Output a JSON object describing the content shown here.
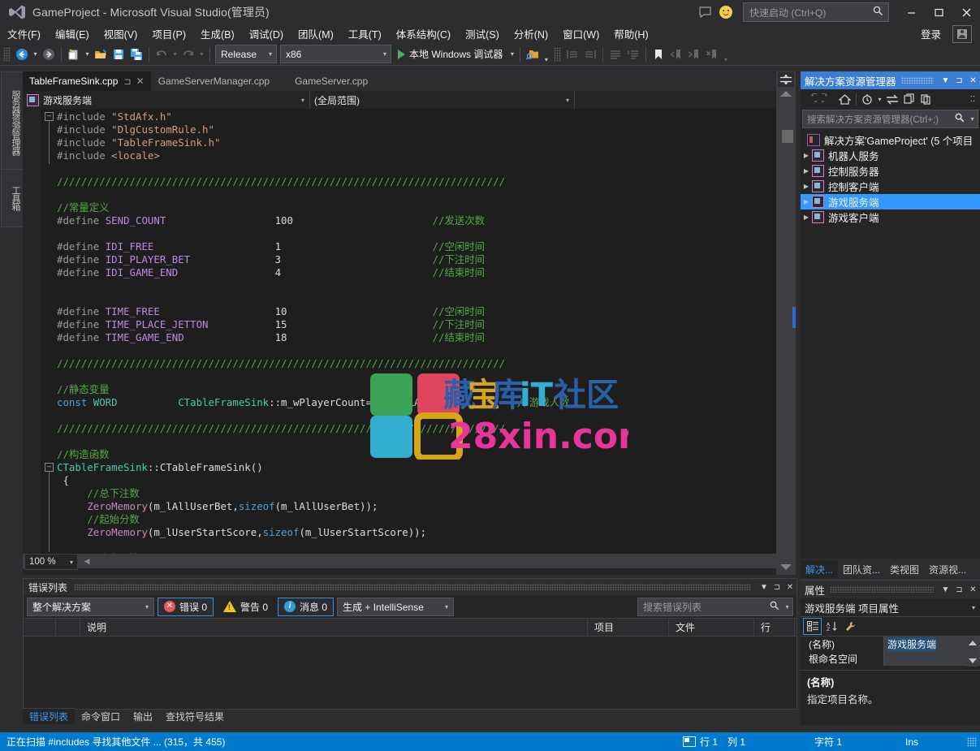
{
  "window": {
    "title": "GameProject - Microsoft Visual Studio(管理员)",
    "logo_icon": "visual-studio-logo",
    "feedback_icon": "feedback-smiley-icon",
    "minimize": "—",
    "maximize": "▢",
    "close": "✕",
    "signin_label": "登录",
    "account_icon": "account-icon"
  },
  "quick_launch": {
    "placeholder": "快速启动 (Ctrl+Q)",
    "icon": "search-icon"
  },
  "menu": [
    "文件(F)",
    "编辑(E)",
    "视图(V)",
    "项目(P)",
    "生成(B)",
    "调试(D)",
    "团队(M)",
    "工具(T)",
    "体系结构(C)",
    "测试(S)",
    "分析(N)",
    "窗口(W)",
    "帮助(H)"
  ],
  "toolbar": {
    "nav_back_icon": "navigate-back-icon",
    "nav_forward_icon": "navigate-forward-icon",
    "new_item_icon": "new-item-icon",
    "open_file_icon": "open-folder-icon",
    "save_icon": "save-icon",
    "save_all_icon": "save-all-icon",
    "undo_icon": "undo-icon",
    "redo_icon": "redo-icon",
    "config_value": "Release",
    "platform_value": "x86",
    "debug_target": "本地 Windows 调试器",
    "find_icon": "find-in-files-icon",
    "outdent_icon": "outdent-icon",
    "indent_icon": "indent-icon",
    "comment_icon": "comment-lines-icon",
    "uncomment_icon": "uncomment-lines-icon",
    "bookmark_icon": "bookmark-icon",
    "prev_bookmark_icon": "previous-bookmark-icon",
    "next_bookmark_icon": "next-bookmark-icon",
    "clear_bookmark_icon": "clear-bookmarks-icon"
  },
  "left_rail": [
    {
      "label": "服务器资源管理器"
    },
    {
      "label": "工具箱"
    }
  ],
  "editor": {
    "tabs": [
      {
        "label": "TableFrameSink.cpp",
        "active": true,
        "pin": "⊐",
        "close": "✕"
      },
      {
        "label": "GameServerManager.cpp",
        "active": false
      },
      {
        "label": "GameServer.cpp",
        "active": false
      }
    ],
    "tab_overflow_icon": "chevron-down-icon",
    "nav_project": "游戏服务端",
    "nav_scope": "(全局范围)",
    "nav_member": "",
    "zoom_level": "100 %",
    "code_lines": [
      [
        {
          "t": "#include ",
          "c": "c-pre"
        },
        {
          "t": "\"StdAfx.h\"",
          "c": "c-str"
        }
      ],
      [
        {
          "t": "#include ",
          "c": "c-pre"
        },
        {
          "t": "\"DlgCustomRule.h\"",
          "c": "c-str"
        }
      ],
      [
        {
          "t": "#include ",
          "c": "c-pre"
        },
        {
          "t": "\"TableFrameSink.h\"",
          "c": "c-str"
        }
      ],
      [
        {
          "t": "#include ",
          "c": "c-pre"
        },
        {
          "t": "<locale>",
          "c": "c-str"
        }
      ],
      [],
      [
        {
          "t": "//////////////////////////////////////////////////////////////////////////",
          "c": "c-cmt"
        }
      ],
      [],
      [
        {
          "t": "//常量定义",
          "c": "c-cmt"
        }
      ],
      [
        {
          "t": "#define ",
          "c": "c-pre"
        },
        {
          "t": "SEND_COUNT",
          "c": "c-mac"
        },
        {
          "t": "                  100                       ",
          "c": "c-id"
        },
        {
          "t": "//发送次数",
          "c": "c-cmt"
        }
      ],
      [],
      [
        {
          "t": "#define ",
          "c": "c-pre"
        },
        {
          "t": "IDI_FREE",
          "c": "c-mac"
        },
        {
          "t": "                    1                         ",
          "c": "c-id"
        },
        {
          "t": "//空闲时间",
          "c": "c-cmt"
        }
      ],
      [
        {
          "t": "#define ",
          "c": "c-pre"
        },
        {
          "t": "IDI_PLAYER_BET",
          "c": "c-mac"
        },
        {
          "t": "              3                         ",
          "c": "c-id"
        },
        {
          "t": "//下注时间",
          "c": "c-cmt"
        }
      ],
      [
        {
          "t": "#define ",
          "c": "c-pre"
        },
        {
          "t": "IDI_GAME_END",
          "c": "c-mac"
        },
        {
          "t": "                4                         ",
          "c": "c-id"
        },
        {
          "t": "//结束时间",
          "c": "c-cmt"
        }
      ],
      [],
      [],
      [
        {
          "t": "#define ",
          "c": "c-pre"
        },
        {
          "t": "TIME_FREE",
          "c": "c-mac"
        },
        {
          "t": "                   10                        ",
          "c": "c-id"
        },
        {
          "t": "//空闲时间",
          "c": "c-cmt"
        }
      ],
      [
        {
          "t": "#define ",
          "c": "c-pre"
        },
        {
          "t": "TIME_PLACE_JETTON",
          "c": "c-mac"
        },
        {
          "t": "           15                        ",
          "c": "c-id"
        },
        {
          "t": "//下注时间",
          "c": "c-cmt"
        }
      ],
      [
        {
          "t": "#define ",
          "c": "c-pre"
        },
        {
          "t": "TIME_GAME_END",
          "c": "c-mac"
        },
        {
          "t": "               18                        ",
          "c": "c-id"
        },
        {
          "t": "//结束时间",
          "c": "c-cmt"
        }
      ],
      [],
      [
        {
          "t": "//////////////////////////////////////////////////////////////////////////",
          "c": "c-cmt"
        }
      ],
      [],
      [
        {
          "t": "//静态变量",
          "c": "c-cmt"
        }
      ],
      [
        {
          "t": "const ",
          "c": "c-kw"
        },
        {
          "t": "WORD",
          "c": "c-typ"
        },
        {
          "t": "          ",
          "c": "c-id"
        },
        {
          "t": "CTableFrameSink",
          "c": "c-cls"
        },
        {
          "t": "::m_wPlayerCount=",
          "c": "c-id"
        },
        {
          "t": "GAME_PLAYER",
          "c": "c-en"
        },
        {
          "t": ";            ",
          "c": "c-id"
        },
        {
          "t": "//游戏人数",
          "c": "c-cmt"
        }
      ],
      [],
      [
        {
          "t": "//////////////////////////////////////////////////////////////////////////",
          "c": "c-cmt"
        }
      ],
      [],
      [
        {
          "t": "//构造函数",
          "c": "c-cmt"
        }
      ],
      [
        {
          "t": "CTableFrameSink",
          "c": "c-cls"
        },
        {
          "t": "::",
          "c": "c-id"
        },
        {
          "t": "CTableFrameSink",
          "c": "c-id"
        },
        {
          "t": "()",
          "c": "c-id"
        }
      ],
      [
        {
          "t": " {",
          "c": "c-id"
        }
      ],
      [
        {
          "t": "     //总下注数",
          "c": "c-cmt"
        }
      ],
      [
        {
          "t": "     ",
          "c": "c-id"
        },
        {
          "t": "ZeroMemory",
          "c": "c-fn"
        },
        {
          "t": "(m_lAllUserBet,",
          "c": "c-id"
        },
        {
          "t": "sizeof",
          "c": "c-kw"
        },
        {
          "t": "(m_lAllUserBet));",
          "c": "c-id"
        }
      ],
      [
        {
          "t": "     //起始分数",
          "c": "c-cmt"
        }
      ],
      [
        {
          "t": "     ",
          "c": "c-id"
        },
        {
          "t": "ZeroMemory",
          "c": "c-fn"
        },
        {
          "t": "(m_lUserStartScore,",
          "c": "c-id"
        },
        {
          "t": "sizeof",
          "c": "c-kw"
        },
        {
          "t": "(m_lUserStartScore));",
          "c": "c-id"
        }
      ],
      [],
      [
        {
          "t": "     //个人下注",
          "c": "c-cmt"
        }
      ]
    ]
  },
  "watermark": {
    "brand_cn": "藏宝库iT社区",
    "brand_url": "28xin.com",
    "logo_colors": [
      "#3aa355",
      "#e0455e",
      "#33aed1",
      "#d6a518"
    ]
  },
  "error_list": {
    "title": "错误列表",
    "scope_value": "整个解决方案",
    "severity": [
      {
        "icon": "error-icon",
        "label": "错误 0",
        "active": true
      },
      {
        "icon": "warning-icon",
        "label": "警告 0",
        "active": false
      },
      {
        "icon": "info-icon",
        "label": "消息 0",
        "active": true
      }
    ],
    "source_value": "生成 + IntelliSense",
    "search_placeholder": "搜索错误列表",
    "search_icon": "search-icon",
    "columns": [
      "",
      "",
      "说明",
      "项目",
      "文件",
      "行"
    ],
    "rows": [],
    "header_buttons": {
      "dropdown": "▼",
      "pin": "⊐",
      "close": "✕"
    }
  },
  "bottom_tabs": [
    {
      "label": "错误列表",
      "active": true
    },
    {
      "label": "命令窗口",
      "active": false
    },
    {
      "label": "输出",
      "active": false
    },
    {
      "label": "查找符号结果",
      "active": false
    }
  ],
  "solution_explorer": {
    "title": "解决方案资源管理器",
    "header_buttons": {
      "dropdown": "▼",
      "pin": "⊐",
      "close": "✕"
    },
    "toolbar_icons": [
      "back-icon",
      "forward-icon",
      "home-icon",
      "pending-changes-icon",
      "sync-with-active-document-icon",
      "refresh-icon",
      "show-all-files-icon",
      "properties-icon",
      "overflow-icon"
    ],
    "search_placeholder": "搜索解决方案资源管理器(Ctrl+;)",
    "search_icon": "search-icon",
    "tree": [
      {
        "label": "解决方案'GameProject' (5 个项目",
        "type": "solution",
        "indent": 0,
        "expander": "",
        "selected": false
      },
      {
        "label": "机器人服务",
        "type": "project",
        "indent": 1,
        "expander": "▶",
        "selected": false
      },
      {
        "label": "控制服务器",
        "type": "project",
        "indent": 1,
        "expander": "▶",
        "selected": false
      },
      {
        "label": "控制客户端",
        "type": "project",
        "indent": 1,
        "expander": "▶",
        "selected": false
      },
      {
        "label": "游戏服务端",
        "type": "project",
        "indent": 1,
        "expander": "▶",
        "selected": true
      },
      {
        "label": "游戏客户端",
        "type": "project",
        "indent": 1,
        "expander": "▶",
        "selected": false
      }
    ]
  },
  "dock_tabs": [
    {
      "label": "解决...",
      "active": true
    },
    {
      "label": "团队资...",
      "active": false
    },
    {
      "label": "类视图",
      "active": false
    },
    {
      "label": "资源视...",
      "active": false
    }
  ],
  "properties": {
    "title": "属性",
    "header_buttons": {
      "dropdown": "▼",
      "pin": "⊐",
      "close": "✕"
    },
    "object": "游戏服务端 项目属性",
    "toolbar_icons": [
      "categorized-icon",
      "alphabetical-icon",
      "property-pages-icon"
    ],
    "rows": [
      {
        "name": "(名称)",
        "value": "游戏服务端",
        "selected": true
      },
      {
        "name": "根命名空间",
        "value": "",
        "selected": false
      }
    ],
    "desc_title": "(名称)",
    "desc_body": "指定项目名称。"
  },
  "status_bar": {
    "message": "正在扫描 #includes 寻找其他文件 ... (315，共 455)",
    "selection_icon": "selection-icon",
    "line": "行 1",
    "column": "列 1",
    "character": "字符 1",
    "insert_mode": "Ins"
  },
  "colors": {
    "accent_blue": "#007acc",
    "panel_header_blue": "#3b7fd4",
    "selection_blue": "#3399ff",
    "chrome_bg": "#2d2d30",
    "editor_bg": "#1e1e1e",
    "tool_bg": "#252526"
  }
}
